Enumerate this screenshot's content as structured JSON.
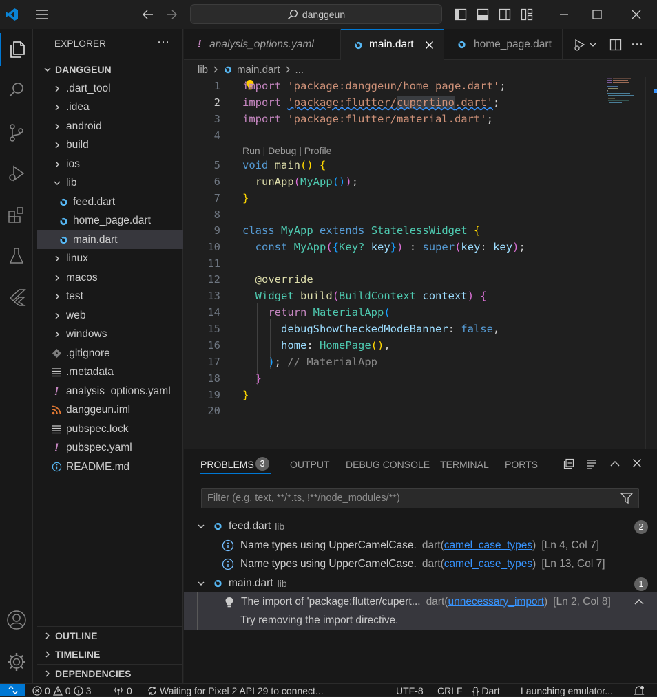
{
  "titlebar": {
    "search_text": "danggeun"
  },
  "sidebar": {
    "title": "EXPLORER",
    "project": "DANGGEUN",
    "tree": [
      {
        "label": ".dart_tool",
        "kind": "folder"
      },
      {
        "label": ".idea",
        "kind": "folder"
      },
      {
        "label": "android",
        "kind": "folder"
      },
      {
        "label": "build",
        "kind": "folder"
      },
      {
        "label": "ios",
        "kind": "folder"
      },
      {
        "label": "lib",
        "kind": "folder-open"
      },
      {
        "label": "feed.dart",
        "kind": "dart"
      },
      {
        "label": "home_page.dart",
        "kind": "dart"
      },
      {
        "label": "main.dart",
        "kind": "dart"
      },
      {
        "label": "linux",
        "kind": "folder"
      },
      {
        "label": "macos",
        "kind": "folder"
      },
      {
        "label": "test",
        "kind": "folder"
      },
      {
        "label": "web",
        "kind": "folder"
      },
      {
        "label": "windows",
        "kind": "folder"
      },
      {
        "label": ".gitignore",
        "kind": "git"
      },
      {
        "label": ".metadata",
        "kind": "lines"
      },
      {
        "label": "analysis_options.yaml",
        "kind": "yaml"
      },
      {
        "label": "danggeun.iml",
        "kind": "rss"
      },
      {
        "label": "pubspec.lock",
        "kind": "lines"
      },
      {
        "label": "pubspec.yaml",
        "kind": "yaml"
      },
      {
        "label": "README.md",
        "kind": "info"
      }
    ],
    "sections": [
      "OUTLINE",
      "TIMELINE",
      "DEPENDENCIES"
    ]
  },
  "tabs": [
    {
      "label": "analysis_options.yaml"
    },
    {
      "label": "main.dart"
    },
    {
      "label": "home_page.dart"
    }
  ],
  "breadcrumb": {
    "folder": "lib",
    "file": "main.dart",
    "rest": "..."
  },
  "editor": {
    "line_numbers": [
      "1",
      "2",
      "3",
      "4",
      "5",
      "6",
      "7",
      "8",
      "9",
      "10",
      "11",
      "12",
      "13",
      "14",
      "15",
      "16",
      "17",
      "18",
      "19",
      "20"
    ],
    "codelens": "Run | Debug | Profile",
    "lines": {
      "l1_kw": "import",
      "l1_str": "'package:danggeun/home_page.dart'",
      "l2_kw": "import",
      "l2_str_a": "'package:flutter/",
      "l2_str_b": "cupertino",
      "l2_str_c": ".dart'",
      "l3_kw": "import",
      "l3_str": "'package:flutter/material.dart'",
      "l5_kw": "void",
      "l5_fn": "main",
      "l6_fn": "runApp",
      "l6_ty": "MyApp",
      "l9_kw": "class",
      "l9_ty": "MyApp",
      "l9_kw2": "extends",
      "l9_ty2": "StatelessWidget",
      "l10_kw": "const",
      "l10_ty": "MyApp",
      "l10_ty2": "Key?",
      "l10_var": "key",
      "l10_kw2": "super",
      "l10_var2": "key",
      "l10_var3": "key",
      "l12_deco": "@override",
      "l13_ty": "Widget",
      "l13_fn": "build",
      "l13_ty2": "BuildContext",
      "l13_var": "context",
      "l14_kw": "return",
      "l14_ty": "MaterialApp",
      "l15_var": "debugShowCheckedModeBanner",
      "l15_kw": "false",
      "l16_var": "home",
      "l16_ty": "HomePage",
      "l17_cm": "// MaterialApp"
    }
  },
  "panel": {
    "tabs": [
      "PROBLEMS",
      "OUTPUT",
      "DEBUG CONSOLE",
      "TERMINAL",
      "PORTS"
    ],
    "problems_count": "3",
    "filter_placeholder": "Filter (e.g. text, **/*.ts, !**/node_modules/**)",
    "groups": [
      {
        "file": "feed.dart",
        "folder": "lib",
        "count": "2",
        "items": [
          {
            "message": "Name types using UpperCamelCase.",
            "source": "dart",
            "code": "camel_case_types",
            "location": "[Ln 4, Col 7]"
          },
          {
            "message": "Name types using UpperCamelCase.",
            "source": "dart",
            "code": "camel_case_types",
            "location": "[Ln 13, Col 7]"
          }
        ]
      },
      {
        "file": "main.dart",
        "folder": "lib",
        "count": "1",
        "items": [
          {
            "message": "The import of 'package:flutter/cupert...",
            "source": "dart",
            "code": "unnecessary_import",
            "location": "[Ln 2, Col 8]",
            "hint": "Try removing the import directive."
          }
        ]
      }
    ]
  },
  "statusbar": {
    "errors": "0",
    "warnings": "0",
    "infos": "3",
    "ports": "0",
    "task": "Waiting for Pixel 2 API 29 to connect...",
    "encoding": "UTF-8",
    "eol": "CRLF",
    "language": "Dart",
    "emulator": "Launching emulator..."
  },
  "colors": {
    "accent": "#0078d4",
    "dart": "#56b6f2",
    "yaml": "#c586c0",
    "info_blue": "#75beff"
  }
}
